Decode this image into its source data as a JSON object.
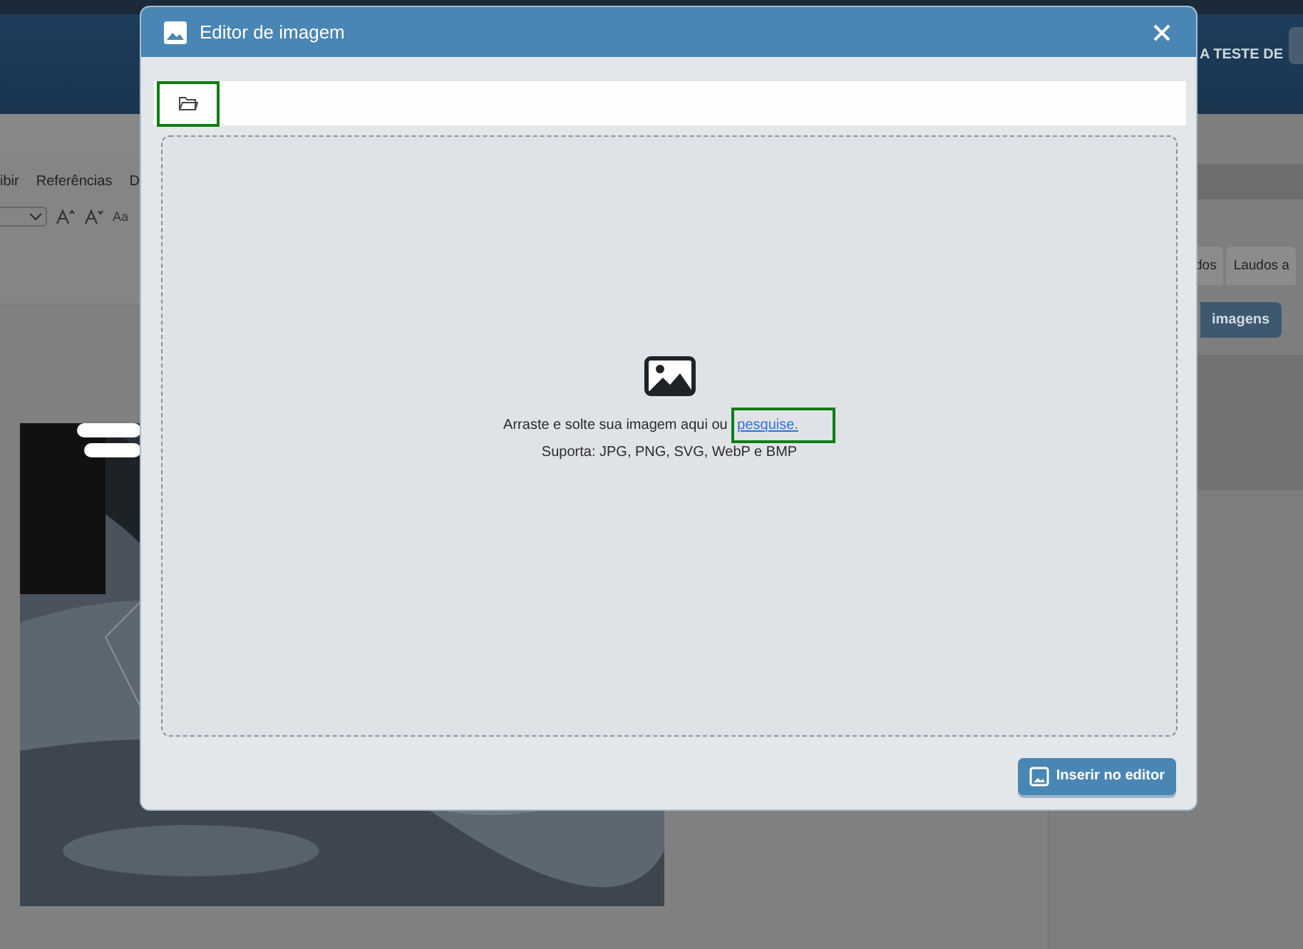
{
  "background": {
    "header_text": "A TESTE DE",
    "menu": [
      "ibir",
      "Referências",
      "D"
    ],
    "format_label": "Aa",
    "tabs": [
      {
        "label": "dos"
      },
      {
        "label": "Laudos a"
      }
    ],
    "images_button": "imagens"
  },
  "dialog": {
    "title": "Editor de imagem",
    "open_button": {
      "highlighted": true
    },
    "drop_text": "Arraste e solte sua imagem aqui ou",
    "link": {
      "label": "pesquise.",
      "highlighted": true
    },
    "supported": "Suporta: JPG, PNG, SVG, WebP e BMP",
    "insert_button": "Inserir no editor"
  }
}
